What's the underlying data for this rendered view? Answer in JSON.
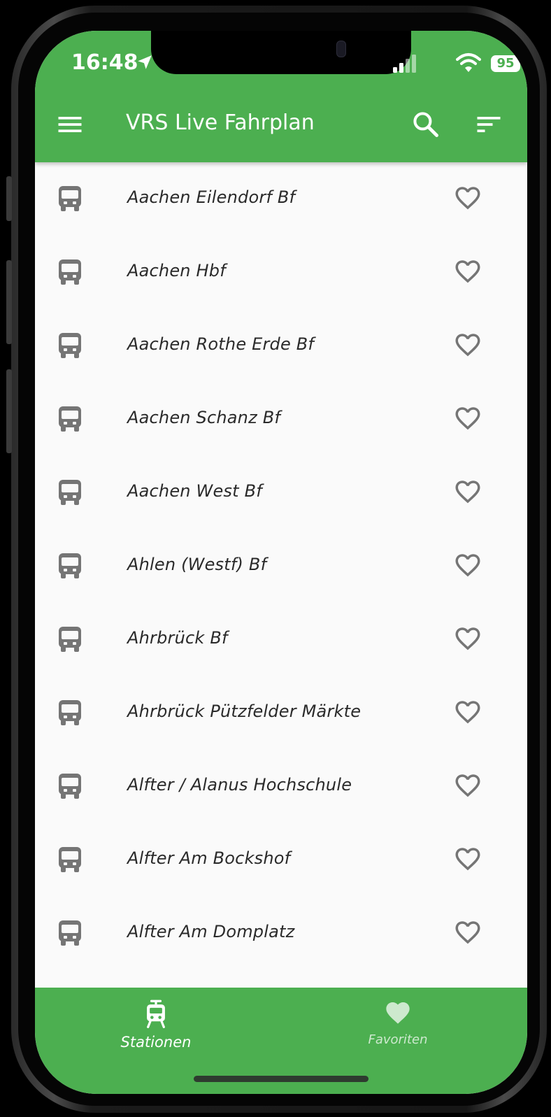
{
  "status_bar": {
    "time": "16:48",
    "battery": "95"
  },
  "app_bar": {
    "title": "VRS Live Fahrplan",
    "menu_icon": "hamburger-menu-icon",
    "search_icon": "search-icon",
    "sort_icon": "sort-icon"
  },
  "stations": [
    {
      "name": "Aachen Eilendorf Bf",
      "favorite": false
    },
    {
      "name": "Aachen Hbf",
      "favorite": false
    },
    {
      "name": "Aachen Rothe Erde Bf",
      "favorite": false
    },
    {
      "name": "Aachen Schanz Bf",
      "favorite": false
    },
    {
      "name": "Aachen West Bf",
      "favorite": false
    },
    {
      "name": "Ahlen (Westf) Bf",
      "favorite": false
    },
    {
      "name": "Ahrbrück Bf",
      "favorite": false
    },
    {
      "name": "Ahrbrück Pützfelder Märkte",
      "favorite": false
    },
    {
      "name": "Alfter / Alanus Hochschule",
      "favorite": false
    },
    {
      "name": "Alfter Am Bockshof",
      "favorite": false
    },
    {
      "name": "Alfter Am Domplatz",
      "favorite": false
    }
  ],
  "bottom_nav": {
    "items": [
      {
        "label": "Stationen",
        "icon": "tram-icon",
        "active": true
      },
      {
        "label": "Favoriten",
        "icon": "heart-filled-icon",
        "active": false
      }
    ]
  },
  "colors": {
    "primary": "#4caf50",
    "list_background": "#fafafa",
    "icon_grey": "#757575",
    "text": "#2a2a2a"
  }
}
